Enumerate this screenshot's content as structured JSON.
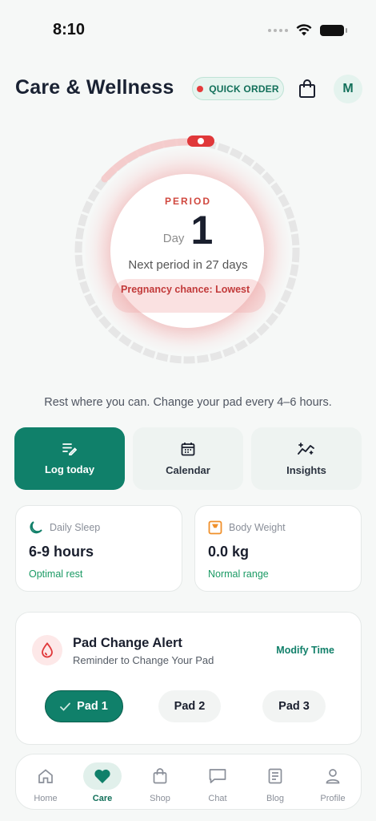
{
  "status_bar": {
    "time": "8:10"
  },
  "header": {
    "title": "Care & Wellness",
    "quick_order_label": "QUICK ORDER",
    "avatar_initial": "M"
  },
  "cycle": {
    "phase_label": "PERIOD",
    "day_word": "Day",
    "day_number": "1",
    "next_period_text": "Next period in 27 days",
    "pregnancy_chance_text": "Pregnancy chance: Lowest"
  },
  "tip_text": "Rest where you can. Change your pad every 4–6 hours.",
  "actions": [
    {
      "label": "Log today",
      "icon": "edit-list-icon",
      "active": true
    },
    {
      "label": "Calendar",
      "icon": "calendar-icon",
      "active": false
    },
    {
      "label": "Insights",
      "icon": "sparkle-chart-icon",
      "active": false
    }
  ],
  "stats": {
    "sleep": {
      "title": "Daily Sleep",
      "value": "6-9 hours",
      "status": "Optimal rest",
      "icon": "moon-icon"
    },
    "weight": {
      "title": "Body Weight",
      "value": "0.0 kg",
      "status": "Normal range",
      "icon": "scale-icon"
    }
  },
  "pad_alert": {
    "title": "Pad Change Alert",
    "subtitle": "Reminder to Change Your Pad",
    "modify_label": "Modify Time",
    "pads": [
      {
        "label": "Pad 1",
        "selected": true
      },
      {
        "label": "Pad 2",
        "selected": false
      },
      {
        "label": "Pad 3",
        "selected": false
      }
    ]
  },
  "nav": [
    {
      "label": "Home",
      "icon": "home-icon"
    },
    {
      "label": "Care",
      "icon": "heart-icon",
      "active": true
    },
    {
      "label": "Shop",
      "icon": "shopping-bag-icon"
    },
    {
      "label": "Chat",
      "icon": "chat-icon"
    },
    {
      "label": "Blog",
      "icon": "blog-icon"
    },
    {
      "label": "Profile",
      "icon": "profile-icon"
    }
  ],
  "colors": {
    "accent": "#10806a",
    "period_red": "#d0483f",
    "status_green": "#1a9a64"
  }
}
